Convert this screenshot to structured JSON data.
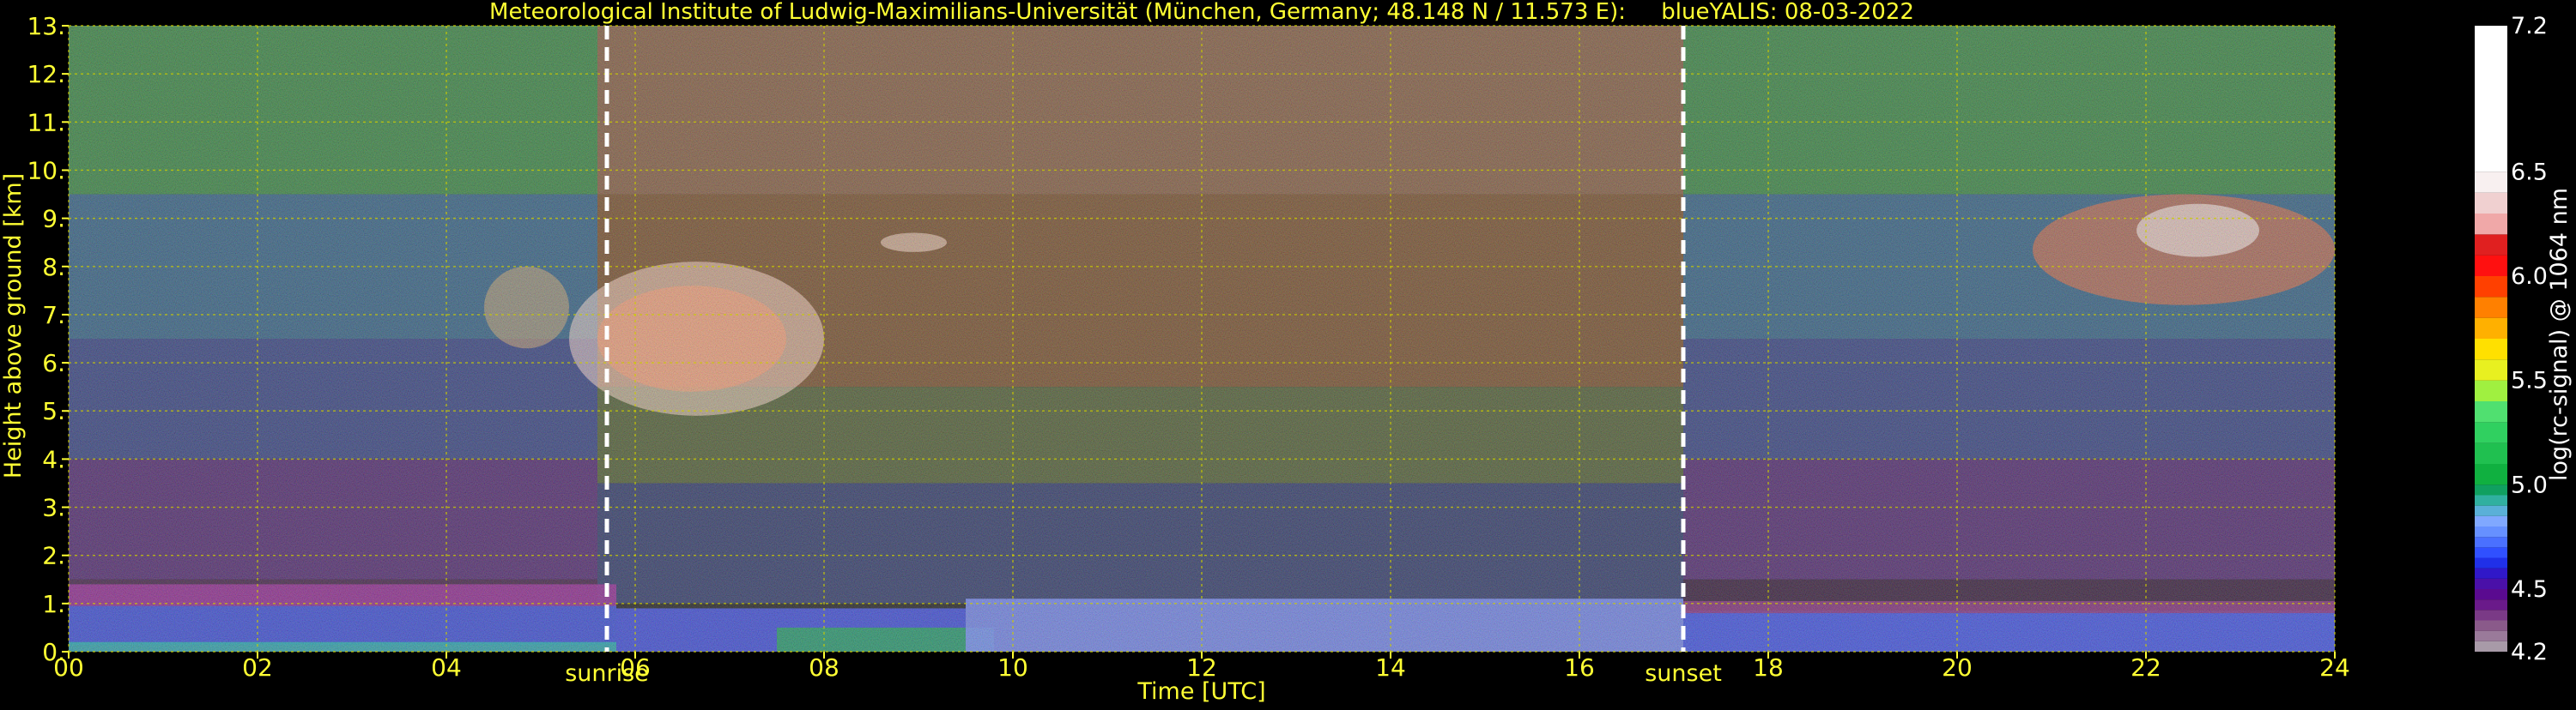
{
  "colors": {
    "background": "#000000",
    "text": "#ffff33",
    "white_text": "#ffffff",
    "grid": "#cccc00",
    "marker": "#ffffff"
  },
  "chart_data": {
    "type": "heatmap",
    "title": "Meteorological Institute of Ludwig-Maximilians-Universität (München, Germany; 48.148 N / 11.573 E):     blueYALIS: 08-03-2022",
    "xlabel": "Time [UTC]",
    "ylabel": "Height above ground [km]",
    "xlim": [
      0,
      24
    ],
    "ylim": [
      0,
      13
    ],
    "x_ticks": [
      0,
      2,
      4,
      6,
      8,
      10,
      12,
      14,
      16,
      18,
      20,
      22,
      24
    ],
    "x_tick_labels": [
      "00",
      "02",
      "04",
      "06",
      "08",
      "10",
      "12",
      "14",
      "16",
      "18",
      "20",
      "22",
      "24"
    ],
    "y_ticks": [
      0,
      1,
      2,
      3,
      4,
      5,
      6,
      7,
      8,
      9,
      10,
      11,
      12,
      13
    ],
    "y_tick_labels": [
      "0.",
      "1.",
      "2.",
      "3.",
      "4.",
      "5.",
      "6.",
      "7.",
      "8.",
      "9.",
      "10.",
      "11.",
      "12.",
      "13."
    ],
    "grid": true,
    "markers": [
      {
        "label": "sunrise",
        "x": 5.7
      },
      {
        "label": "sunset",
        "x": 17.1
      }
    ],
    "colorbar": {
      "label": "log(rc-signal) @ 1064 nm",
      "range": [
        4.2,
        7.2
      ],
      "tick_values": [
        4.2,
        4.5,
        5.0,
        5.5,
        6.0,
        6.5,
        7.2
      ],
      "tick_labels": [
        "4.2",
        "4.5",
        "5.0",
        "5.5",
        "6.0",
        "6.5",
        "7.2"
      ],
      "bands": [
        {
          "from": 4.2,
          "to": 4.25,
          "color": "#a89aa8"
        },
        {
          "from": 4.25,
          "to": 4.3,
          "color": "#9a7a9a"
        },
        {
          "from": 4.3,
          "to": 4.35,
          "color": "#8a5a8a"
        },
        {
          "from": 4.35,
          "to": 4.4,
          "color": "#7a3a86"
        },
        {
          "from": 4.4,
          "to": 4.45,
          "color": "#6a1a8a"
        },
        {
          "from": 4.45,
          "to": 4.5,
          "color": "#5a0a90"
        },
        {
          "from": 4.5,
          "to": 4.55,
          "color": "#4a10a8"
        },
        {
          "from": 4.55,
          "to": 4.6,
          "color": "#3018c8"
        },
        {
          "from": 4.6,
          "to": 4.65,
          "color": "#2030e8"
        },
        {
          "from": 4.65,
          "to": 4.7,
          "color": "#3050ff"
        },
        {
          "from": 4.7,
          "to": 4.75,
          "color": "#4a70ff"
        },
        {
          "from": 4.75,
          "to": 4.8,
          "color": "#6690ff"
        },
        {
          "from": 4.8,
          "to": 4.85,
          "color": "#80a8ff"
        },
        {
          "from": 4.85,
          "to": 4.9,
          "color": "#5ab0d8"
        },
        {
          "from": 4.9,
          "to": 4.95,
          "color": "#30b0a0"
        },
        {
          "from": 4.95,
          "to": 5.0,
          "color": "#10a060"
        },
        {
          "from": 5.0,
          "to": 5.1,
          "color": "#10b040"
        },
        {
          "from": 5.1,
          "to": 5.2,
          "color": "#20c050"
        },
        {
          "from": 5.2,
          "to": 5.3,
          "color": "#30d060"
        },
        {
          "from": 5.3,
          "to": 5.4,
          "color": "#50e070"
        },
        {
          "from": 5.4,
          "to": 5.5,
          "color": "#a0f040"
        },
        {
          "from": 5.5,
          "to": 5.6,
          "color": "#e8f020"
        },
        {
          "from": 5.6,
          "to": 5.7,
          "color": "#ffe000"
        },
        {
          "from": 5.7,
          "to": 5.8,
          "color": "#ffb000"
        },
        {
          "from": 5.8,
          "to": 5.9,
          "color": "#ff8000"
        },
        {
          "from": 5.9,
          "to": 6.0,
          "color": "#ff4000"
        },
        {
          "from": 6.0,
          "to": 6.1,
          "color": "#ff1010"
        },
        {
          "from": 6.1,
          "to": 6.2,
          "color": "#e02020"
        },
        {
          "from": 6.2,
          "to": 6.3,
          "color": "#f0a8a8"
        },
        {
          "from": 6.3,
          "to": 6.4,
          "color": "#f0d0d0"
        },
        {
          "from": 6.4,
          "to": 6.5,
          "color": "#f8f0f0"
        },
        {
          "from": 6.5,
          "to": 7.2,
          "color": "#ffffff"
        }
      ]
    },
    "color_regions": [
      {
        "x": [
          0,
          5.6
        ],
        "y": [
          9.5,
          13.0
        ],
        "color": "#2e8a3a"
      },
      {
        "x": [
          0,
          5.6
        ],
        "y": [
          6.5,
          9.5
        ],
        "color": "#285f8a"
      },
      {
        "x": [
          0,
          5.6
        ],
        "y": [
          4.0,
          6.5
        ],
        "color": "#2a3a86"
      },
      {
        "x": [
          0,
          5.6
        ],
        "y": [
          1.5,
          4.0
        ],
        "color": "#4a1a70"
      },
      {
        "x": [
          0,
          5.6
        ],
        "y": [
          0,
          1.5
        ],
        "color": "#3a1040"
      },
      {
        "x": [
          5.6,
          17.1
        ],
        "y": [
          9.5,
          13.0
        ],
        "color": "#8a5a3a"
      },
      {
        "x": [
          5.6,
          17.1
        ],
        "y": [
          5.5,
          9.5
        ],
        "color": "#7a4a20"
      },
      {
        "x": [
          5.6,
          17.1
        ],
        "y": [
          3.5,
          5.5
        ],
        "color": "#4a5a28"
      },
      {
        "x": [
          5.6,
          17.1
        ],
        "y": [
          1.0,
          3.5
        ],
        "color": "#24306a"
      },
      {
        "x": [
          5.6,
          17.1
        ],
        "y": [
          0,
          1.0
        ],
        "color": "#101010"
      },
      {
        "x": [
          17.1,
          24
        ],
        "y": [
          9.5,
          13.0
        ],
        "color": "#2e8a3a"
      },
      {
        "x": [
          17.1,
          24
        ],
        "y": [
          6.5,
          9.5
        ],
        "color": "#285f8a"
      },
      {
        "x": [
          17.1,
          24
        ],
        "y": [
          4.0,
          6.5
        ],
        "color": "#2a3a86"
      },
      {
        "x": [
          17.1,
          24
        ],
        "y": [
          1.5,
          4.0
        ],
        "color": "#4a1a70"
      },
      {
        "x": [
          17.1,
          24
        ],
        "y": [
          0,
          1.5
        ],
        "color": "#2a0a30"
      }
    ],
    "boundary_layer": [
      {
        "x": [
          0,
          5.8
        ],
        "y": [
          0,
          1.4
        ],
        "color": "#8a1a8a"
      },
      {
        "x": [
          0,
          5.8
        ],
        "y": [
          0.15,
          0.95
        ],
        "color": "#2040d0"
      },
      {
        "x": [
          0,
          5.8
        ],
        "y": [
          0,
          0.2
        ],
        "color": "#10a0a0"
      },
      {
        "x": [
          5.8,
          9.5
        ],
        "y": [
          0,
          0.9
        ],
        "color": "#3040e0"
      },
      {
        "x": [
          7.5,
          9.8
        ],
        "y": [
          0,
          0.5
        ],
        "color": "#109050"
      },
      {
        "x": [
          9.5,
          17.1
        ],
        "y": [
          0,
          1.1
        ],
        "color": "#6a80f0"
      },
      {
        "x": [
          17.1,
          24
        ],
        "y": [
          0,
          0.85
        ],
        "color": "#3048e8"
      },
      {
        "x": [
          17.1,
          24
        ],
        "y": [
          0.8,
          1.05
        ],
        "color": "#7a2070"
      }
    ],
    "cloud_layers": [
      {
        "x": [
          5.3,
          8.0
        ],
        "y": [
          4.9,
          8.1
        ],
        "color": "#ffd8c8"
      },
      {
        "x": [
          5.6,
          7.6
        ],
        "y": [
          5.4,
          7.6
        ],
        "color": "#ff9060"
      },
      {
        "x": [
          8.6,
          9.3
        ],
        "y": [
          8.3,
          8.7
        ],
        "color": "#ffe0d0"
      },
      {
        "x": [
          4.4,
          5.3
        ],
        "y": [
          6.3,
          8.0
        ],
        "color": "#d0a060"
      },
      {
        "x": [
          20.8,
          24
        ],
        "y": [
          7.2,
          9.5
        ],
        "color": "#ff6020"
      },
      {
        "x": [
          21.9,
          23.2
        ],
        "y": [
          8.2,
          9.3
        ],
        "color": "#ffffff"
      }
    ]
  }
}
